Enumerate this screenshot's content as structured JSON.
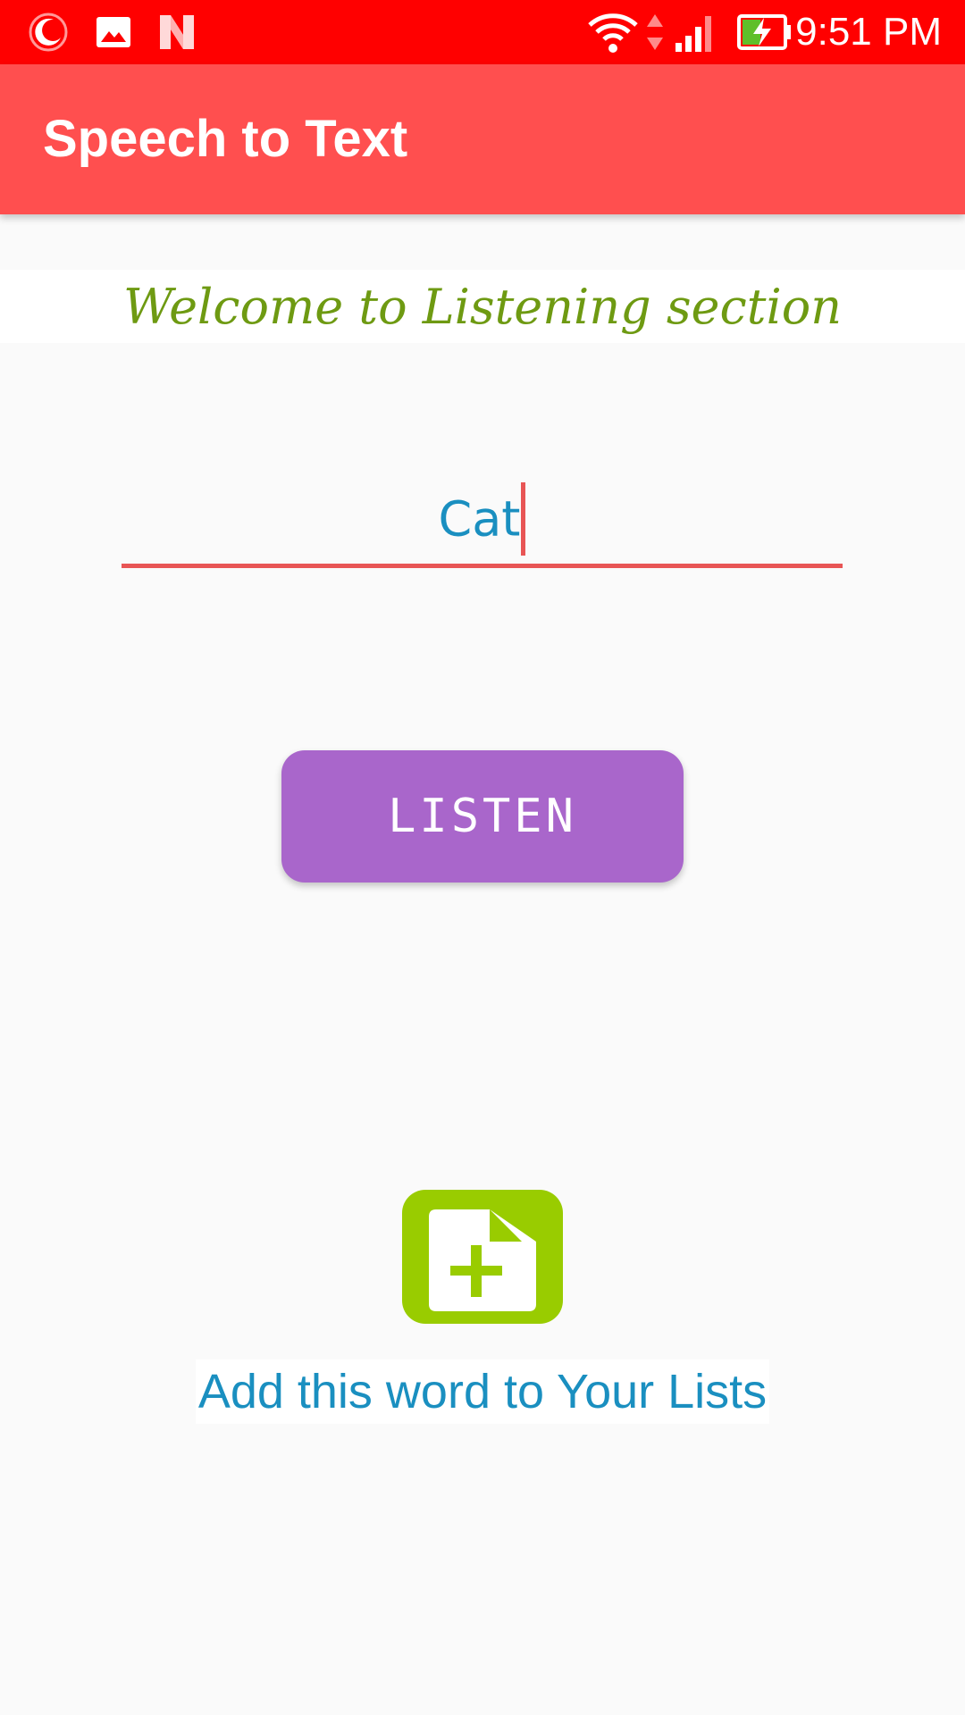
{
  "status_bar": {
    "time": "9:51 PM",
    "icons": [
      "moon-icon",
      "image-icon",
      "n-logo-icon",
      "wifi-icon",
      "data-arrows-icon",
      "signal-icon",
      "battery-charging-icon"
    ],
    "background": "#ff0000"
  },
  "app_bar": {
    "title": "Speech to Text",
    "background": "#ff4f4f"
  },
  "welcome": {
    "text": "Welcome to Listening section",
    "color": "#6e9a12"
  },
  "word_input": {
    "value": "Cat",
    "text_color": "#1a8fc0",
    "underline_color": "#e85555"
  },
  "listen_button": {
    "label": "LISTEN",
    "background": "#a966cb"
  },
  "add_word": {
    "icon": "add-file-icon",
    "icon_color": "#99cc00",
    "label": "Add this word to Your Lists",
    "label_color": "#1a8fc0"
  }
}
